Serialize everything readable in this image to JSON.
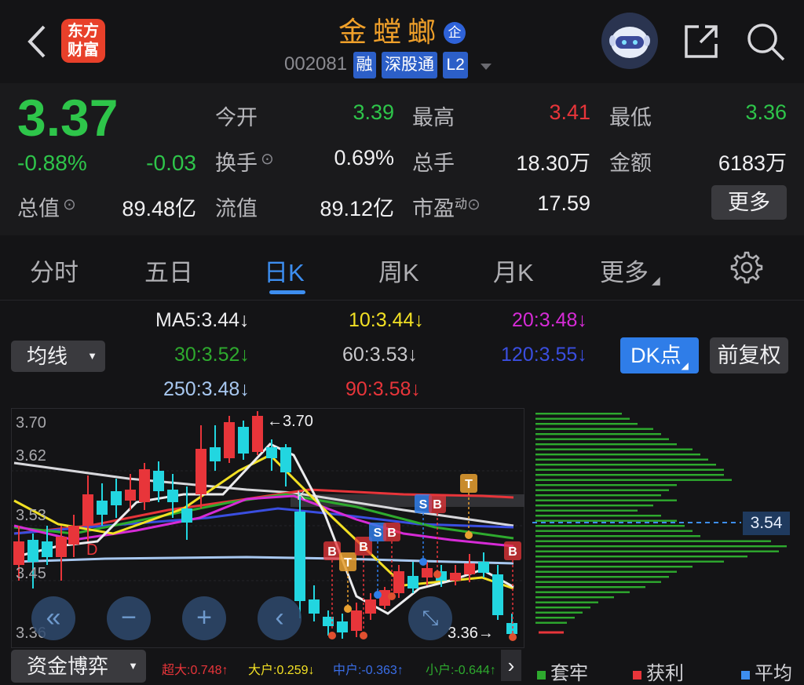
{
  "header": {
    "title": "金螳螂",
    "title_badge": "企",
    "code": "002081",
    "tags": [
      "融",
      "深股通",
      "L2"
    ],
    "logo_line1": "东方",
    "logo_line2": "财富"
  },
  "quote": {
    "price": "3.37",
    "change_pct": "-0.88%",
    "change": "-0.03",
    "open_label": "今开",
    "open": "3.39",
    "high_label": "最高",
    "high": "3.41",
    "low_label": "最低",
    "low": "3.36",
    "turnover_label": "换手",
    "turnover": "0.69%",
    "volume_label": "总手",
    "volume": "18.30万",
    "amount_label": "金额",
    "amount": "6183万",
    "mktcap_label": "总值",
    "mktcap": "89.48亿",
    "float_label": "流值",
    "float": "89.12亿",
    "pe_label": "市盈",
    "pe_sup": "动",
    "pe": "17.59",
    "more": "更多"
  },
  "tabs": [
    "分时",
    "五日",
    "日K",
    "周K",
    "月K",
    "更多"
  ],
  "ma": {
    "ma5": "MA5:3.44↓",
    "ma10": "10:3.44↓",
    "ma20": "20:3.48↓",
    "ma30": "30:3.52↓",
    "ma60": "60:3.53↓",
    "ma120": "120:3.55↓",
    "ma250": "250:3.48↓",
    "ma90": "90:3.58↓"
  },
  "toolbar": {
    "indicator": "均线",
    "dk": "DK点",
    "fq": "前复权"
  },
  "chart": {
    "y_labels": [
      "3.70",
      "3.62",
      "3.53",
      "3.45",
      "3.36"
    ],
    "high_mark": "←3.70",
    "low_mark": "3.36→",
    "chip_level": "3.54",
    "marker_d": "D",
    "marker_k": "K"
  },
  "flow": {
    "label": "资金博弈",
    "super": "超大:0.748↑",
    "big": "大户:0.259↓",
    "mid": "中户:-0.363↑",
    "small": "小户:-0.644↑"
  },
  "legend": {
    "trapped": "套牢",
    "profit": "获利",
    "avg": "平均"
  },
  "colors": {
    "up": "#e8353a",
    "down": "#22d6e0",
    "accent": "#f0a02a",
    "green": "#2ec54a"
  }
}
